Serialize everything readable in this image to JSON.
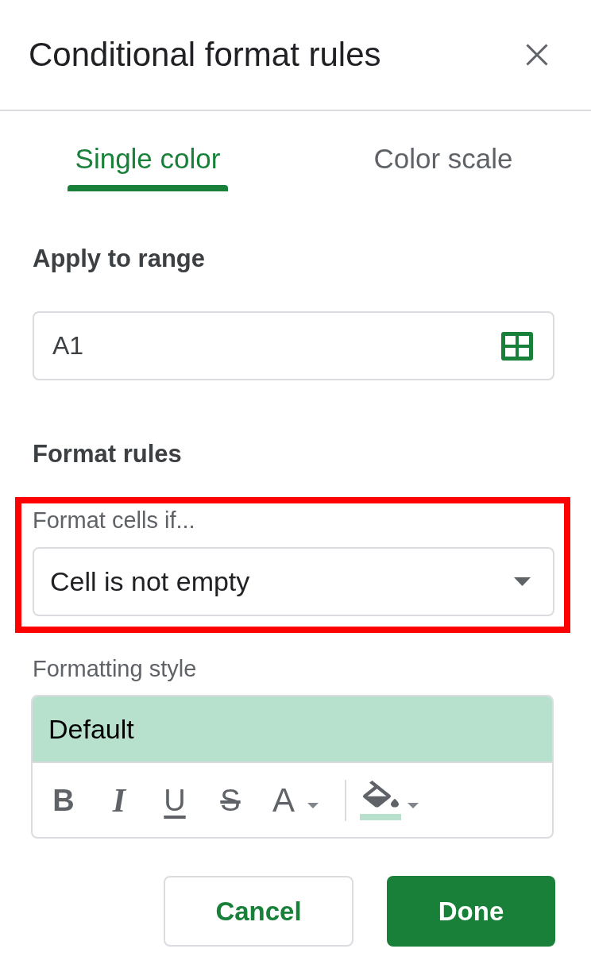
{
  "panel": {
    "title": "Conditional format rules"
  },
  "tabs": [
    {
      "label": "Single color",
      "selected": true
    },
    {
      "label": "Color scale",
      "selected": false
    }
  ],
  "range_section": {
    "heading": "Apply to range",
    "value": "A1"
  },
  "rules_section": {
    "heading": "Format rules",
    "condition_label": "Format cells if...",
    "condition_value": "Cell is not empty",
    "highlighted": true
  },
  "style_section": {
    "label": "Formatting style",
    "preview_text": "Default",
    "toolbar_groups": [
      {
        "items": [
          {
            "kind": "bold",
            "label": "B"
          },
          {
            "kind": "italic",
            "label": "I"
          },
          {
            "kind": "underline",
            "label": "U"
          },
          {
            "kind": "strikethrough",
            "label": "S"
          },
          {
            "kind": "text_color",
            "label": "A",
            "dropdown": true
          }
        ]
      },
      {
        "items": [
          {
            "kind": "fill_color",
            "color": "#b7e1cd",
            "dropdown": true
          }
        ]
      }
    ]
  },
  "buttons": [
    {
      "label": "Cancel",
      "kind": "cancel"
    },
    {
      "label": "Done",
      "kind": "confirm"
    }
  ]
}
